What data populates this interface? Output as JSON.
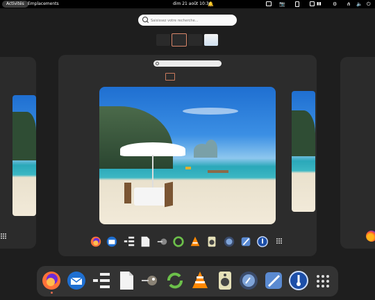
{
  "topbar": {
    "activities": "Activités",
    "places": "Emplacements",
    "clock": "dim 21 août  10:34"
  },
  "search": {
    "placeholder": "Saisissez votre recherche…"
  },
  "colors": {
    "active_workspace": "#d9866a",
    "panel": "#000000",
    "background": "#1e1e1e"
  },
  "workspaces": {
    "count": 4,
    "active_index": 1
  },
  "dock": {
    "apps": [
      "firefox-icon",
      "thunderbird-icon",
      "file-tree-icon",
      "text-editor-icon",
      "gimp-icon",
      "sync-icon",
      "vlc-icon",
      "speaker-icon",
      "compass-icon",
      "inkscape-icon",
      "thermometer-icon",
      "app-grid-icon"
    ]
  }
}
